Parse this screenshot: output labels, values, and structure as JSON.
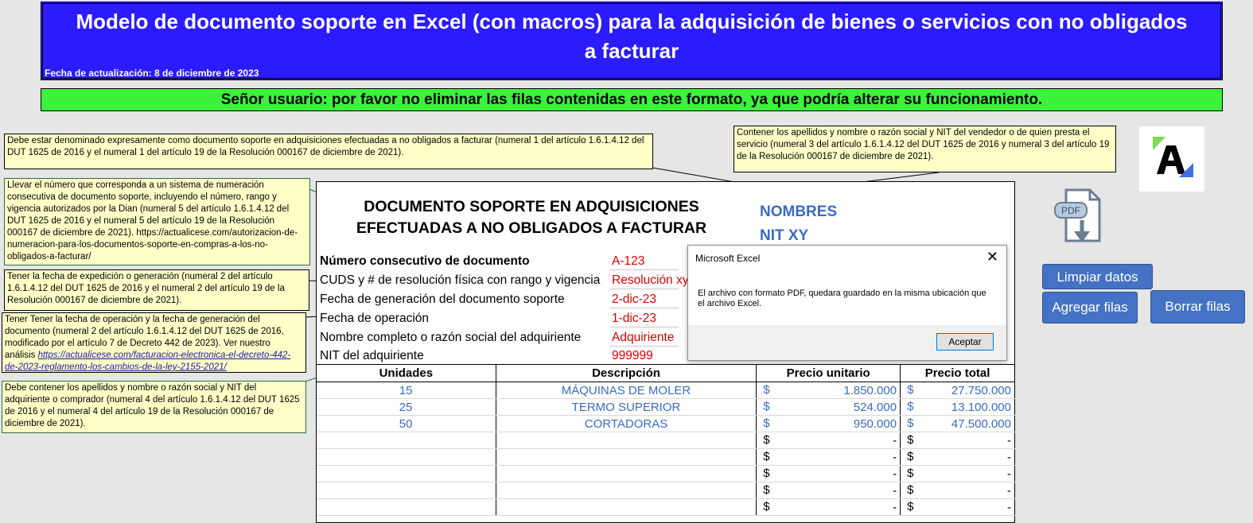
{
  "header": {
    "title": "Modelo de documento soporte en Excel (con macros) para la adquisición de bienes o servicios con no obligados a facturar",
    "update_date": "Fecha de actualización: 8 de diciembre de 2023"
  },
  "warning": "Señor usuario: por favor no eliminar las filas contenidas en este formato, ya que podría alterar su funcionamiento.",
  "notes": {
    "denominacion": "Debe estar denominado expresamente como documento soporte en adquisiciones efectuadas a no obligados a facturar (numeral 1 del artículo 1.6.1.4.12 del DUT 1625 de 2016 y el numeral 1 del artículo 19 de la Resolución 000167 de diciembre de 2021).",
    "vendedor": "Contener los apellidos y nombre o razón social y NIT del vendedor o de quien presta el servicio (numeral 3 del artículo 1.6.1.4.12 del DUT 1625 de 2016 y numeral 3 del artículo 19 de la Resolución 000167 de diciembre de 2021).",
    "numeracion": "Llevar el número que corresponda a un sistema de numeración consecutiva de documento soporte, incluyendo el número, rango y vigencia autorizados por la Dian (numeral 5 del artículo 1.6.1.4.12 del DUT 1625 de 2016 y el numeral 5 del artículo 19 de la Resolución 000167 de diciembre de 2021). https://actualicese.com/autorizacion-de-numeracion-para-los-documentos-soporte-en-compras-a-los-no-obligados-a-facturar/",
    "fecha_expedicion": "Tener la fecha de expedición o generación (numeral 2 del artículo 1.6.1.4.12 del DUT 1625 de 2016 y el numeral 2 del artículo 19 de la Resolución 000167 de diciembre de 2021).",
    "fecha_operacion": "Tener Tener la fecha de operación y la fecha de generación del documento (numeral 2 del artículo 1.6.1.4.12 del DUT 1625 de 2016, modificado por el artículo 7 de Decreto 442 de 2023). Ver nuestro análisis",
    "fecha_operacion_link": "https://actualicese.com/facturacion-electronica-el-decreto-442-de-2023-reglamento-los-cambios-de-la-ley-2155-2021/",
    "adquiriente": "Debe contener los apellidos y nombre o razón social y NIT del adquiriente o comprador (numeral 4 del artículo 1.6.1.4.12 del DUT 1625 de 2016 y el numeral 4 del artículo 19 de la Resolución 000167 de diciembre de 2021)."
  },
  "document": {
    "title": "DOCUMENTO SOPORTE EN ADQUISICIONES EFECTUADAS A NO OBLIGADOS A FACTURAR",
    "vendor_name": "NOMBRES",
    "vendor_nit": "NIT XY",
    "fields": [
      {
        "label": "Número consecutivo de documento",
        "value": "A-123"
      },
      {
        "label": "CUDS y # de resolución física con rango y vigencia",
        "value": "Resolución xy"
      },
      {
        "label": "Fecha de generación del documento soporte",
        "value": "2-dic-23"
      },
      {
        "label": "Fecha de operación",
        "value": "1-dic-23"
      },
      {
        "label": "Nombre completo o razón social del adquiriente",
        "value": "Adquiriente"
      },
      {
        "label": "NIT del adquiriente",
        "value": "999999"
      }
    ]
  },
  "table": {
    "headers": [
      "Unidades",
      "Descripción",
      "Precio unitario",
      "Precio total"
    ],
    "currency": "$",
    "rows": [
      {
        "units": "15",
        "desc": "MÁQUINAS DE MOLER",
        "unit_price": "1.850.000",
        "total": "27.750.000"
      },
      {
        "units": "25",
        "desc": "TERMO SUPERIOR",
        "unit_price": "524.000",
        "total": "13.100.000"
      },
      {
        "units": "50",
        "desc": "CORTADORAS",
        "unit_price": "950.000",
        "total": "47.500.000"
      },
      {
        "units": "",
        "desc": "",
        "unit_price": "-",
        "total": "-"
      },
      {
        "units": "",
        "desc": "",
        "unit_price": "-",
        "total": "-"
      },
      {
        "units": "",
        "desc": "",
        "unit_price": "-",
        "total": "-"
      },
      {
        "units": "",
        "desc": "",
        "unit_price": "-",
        "total": "-"
      },
      {
        "units": "",
        "desc": "",
        "unit_price": "-",
        "total": "-"
      }
    ]
  },
  "dialog": {
    "title": "Microsoft Excel",
    "message": "El archivo con formato PDF, quedara guardado en la misma ubicación que el archivo Excel.",
    "ok_label": "Aceptar"
  },
  "buttons": {
    "clear": "Limpiar datos",
    "add_rows": "Agregar filas",
    "delete_rows": "Borrar filas"
  },
  "pdf_icon_label": "PDF",
  "colors": {
    "banner_blue": "#2a1cff",
    "banner_green": "#3cf23c",
    "note_bg": "#ffffc8",
    "value_red": "#e00000",
    "data_blue": "#3a6bc4",
    "button_blue": "#4472c4"
  }
}
